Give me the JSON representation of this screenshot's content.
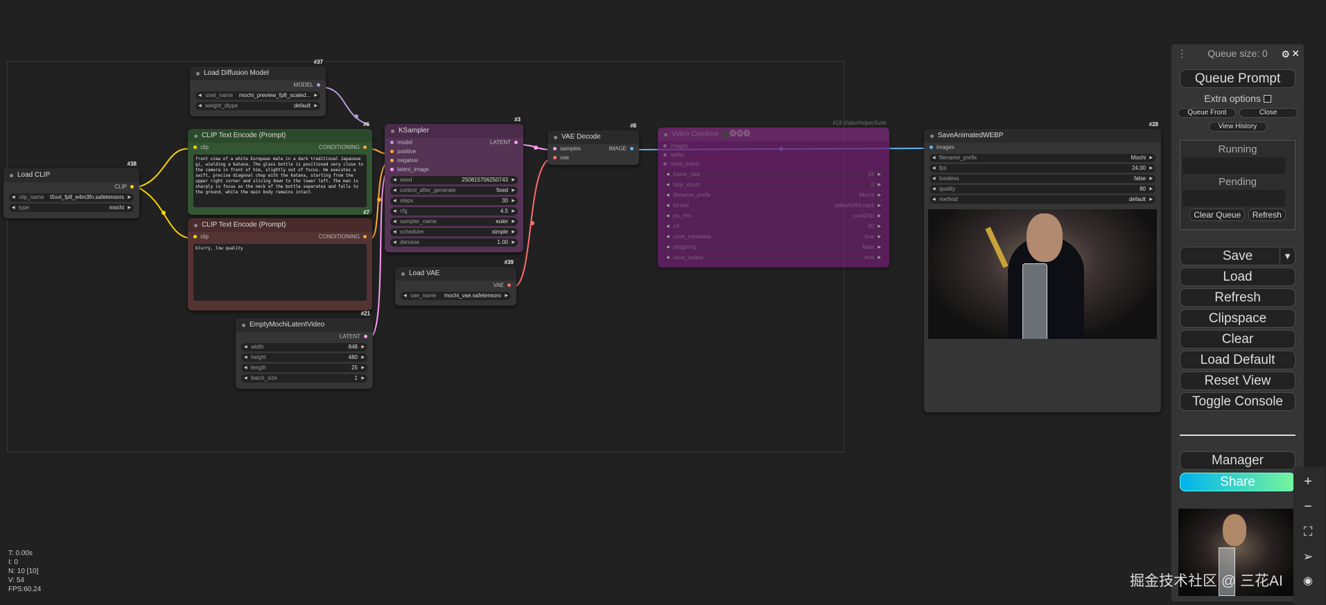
{
  "nodes": {
    "load_diffusion": {
      "id": "#37",
      "title": "Load Diffusion Model",
      "output": "MODEL",
      "widgets": [
        {
          "label": "unet_name",
          "value": "mochi_preview_fp8_scaled..."
        },
        {
          "label": "weight_dtype",
          "value": "default"
        }
      ]
    },
    "load_clip": {
      "id": "#38",
      "title": "Load CLIP",
      "output": "CLIP",
      "widgets": [
        {
          "label": "clip_name",
          "value": "t5xxl_fp8_e4m3fn.safetensors"
        },
        {
          "label": "type",
          "value": "mochi"
        }
      ]
    },
    "clip_pos": {
      "id": "#6",
      "title": "CLIP Text Encode (Prompt)",
      "input": "clip",
      "output": "CONDITIONING",
      "text": "front view of a white European male in a dark traditional Japanese gi, wielding a katana. The glass bottle is positioned very close to the camera in front of him, slightly out of focus. He executes a swift, precise diagonal chop with the katana, starting from the upper right corner and slicing down to the lower left. The man is sharply in focus as the neck of the bottle separates and falls to the ground, while the main body remains intact."
    },
    "clip_neg": {
      "id": "#7",
      "title": "CLIP Text Encode (Prompt)",
      "input": "clip",
      "output": "CONDITIONING",
      "text": "blurry, low quality"
    },
    "ksampler": {
      "id": "#3",
      "title": "KSampler",
      "inputs": [
        "model",
        "positive",
        "negative",
        "latent_image"
      ],
      "output": "LATENT",
      "widgets": [
        {
          "label": "seed",
          "value": "250815706250743"
        },
        {
          "label": "control_after_generate",
          "value": "fixed"
        },
        {
          "label": "steps",
          "value": "30"
        },
        {
          "label": "cfg",
          "value": "4.5"
        },
        {
          "label": "sampler_name",
          "value": "euler"
        },
        {
          "label": "scheduler",
          "value": "simple"
        },
        {
          "label": "denoise",
          "value": "1.00"
        }
      ]
    },
    "vae_decode": {
      "id": "#8",
      "title": "VAE Decode",
      "inputs": [
        "samples",
        "vae"
      ],
      "output": "IMAGE"
    },
    "load_vae": {
      "id": "#39",
      "title": "Load VAE",
      "output": "VAE",
      "widgets": [
        {
          "label": "vae_name",
          "value": "mochi_vae.safetensors"
        }
      ]
    },
    "empty_latent": {
      "id": "#21",
      "title": "EmptyMochiLatentVideo",
      "output": "LATENT",
      "widgets": [
        {
          "label": "width",
          "value": "848"
        },
        {
          "label": "height",
          "value": "480"
        },
        {
          "label": "length",
          "value": "25"
        },
        {
          "label": "batch_size",
          "value": "1"
        }
      ]
    },
    "video_combine": {
      "id": "#18 VideoHelperSuite",
      "title": "Video Combine 🎥🅥🅗🅢",
      "inputs": [
        "images",
        "audio",
        "meta_batch"
      ],
      "widgets": [
        {
          "label": "frame_rate",
          "value": "24"
        },
        {
          "label": "loop_count",
          "value": "0"
        },
        {
          "label": "filename_prefix",
          "value": "Mochi"
        },
        {
          "label": "format",
          "value": "video/h264-mp4"
        },
        {
          "label": "pix_fmt",
          "value": "yuv420p"
        },
        {
          "label": "crf",
          "value": "20"
        },
        {
          "label": "save_metadata",
          "value": "true"
        },
        {
          "label": "pingpong",
          "value": "false"
        },
        {
          "label": "save_output",
          "value": "true"
        }
      ]
    },
    "save_webp": {
      "id": "#28",
      "title": "SaveAnimatedWEBP",
      "input": "images",
      "widgets": [
        {
          "label": "filename_prefix",
          "value": "Mochi"
        },
        {
          "label": "fps",
          "value": "24.00"
        },
        {
          "label": "lossless",
          "value": "false"
        },
        {
          "label": "quality",
          "value": "80"
        },
        {
          "label": "method",
          "value": "default"
        }
      ]
    }
  },
  "panel": {
    "queue_size": "Queue size: 0",
    "queue_prompt": "Queue Prompt",
    "extra_options": "Extra options",
    "queue_front": "Queue Front",
    "close": "Close",
    "view_history": "View History",
    "running": "Running",
    "pending": "Pending",
    "clear_queue": "Clear Queue",
    "refresh_small": "Refresh",
    "save": "Save",
    "load": "Load",
    "refresh": "Refresh",
    "clipspace": "Clipspace",
    "clear": "Clear",
    "load_default": "Load Default",
    "reset_view": "Reset View",
    "toggle_console": "Toggle Console",
    "manager": "Manager",
    "share": "Share"
  },
  "stats": {
    "t": "T: 0.00s",
    "i": "I: 0",
    "n": "N: 10 [10]",
    "v": "V: 54",
    "fps": "FPS:60.24"
  },
  "watermark": "掘金技术社区 @ 三花AI",
  "colors": {
    "clip": "#ffd500",
    "model": "#b39ddb",
    "latent": "#ff9cf9",
    "vae": "#ff6e6e",
    "image": "#64b5f6",
    "conditioning": "#ffa931"
  }
}
